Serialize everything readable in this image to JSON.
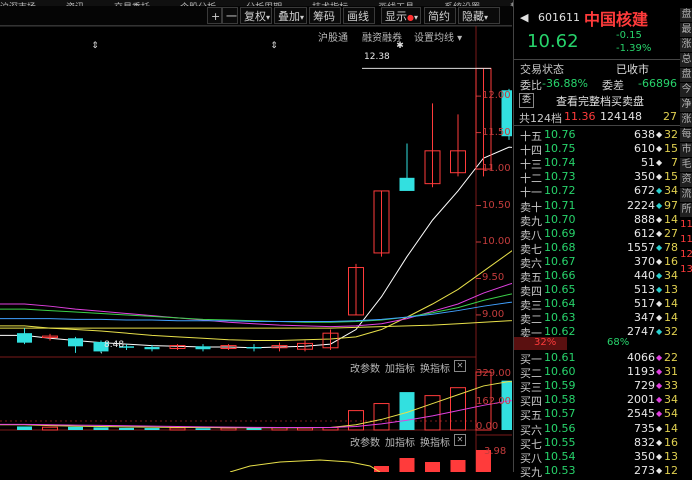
{
  "topbar": {
    "tabs": [
      "沪深市场",
      "资讯",
      "交易委托",
      "个股分析",
      "分析周期",
      "技术指标",
      "画线工具",
      "系统设置",
      "帮助"
    ]
  },
  "toolbar": {
    "plus": "+",
    "minus": "一",
    "fuquan": "复权",
    "diejia": "叠加",
    "chouma": "筹码",
    "huaxian": "画线",
    "xianshi": "显示",
    "jianyue": "简约",
    "yincang": "隐藏",
    "caret": "▾",
    "reddot": "●"
  },
  "chart_header": {
    "hugutong": "沪股通",
    "rongzi": "融资融券",
    "settings": "设置均线 ▾"
  },
  "price_axis": [
    "12.00",
    "11.50",
    "11.00",
    "10.50",
    "10.00",
    "9.50",
    "9.00"
  ],
  "annotations": {
    "high": "12.38",
    "low": "8.48"
  },
  "indicators": [
    {
      "buttons": [
        "改参数",
        "加指标",
        "换指标"
      ],
      "ticks": [
        "329.00",
        "162.00",
        "0.00"
      ]
    },
    {
      "buttons": [
        "改参数",
        "加指标",
        "换指标"
      ],
      "ticks": [
        "3.98"
      ]
    }
  ],
  "chart_data": {
    "type": "candlestick",
    "y_range": [
      8.3,
      12.55
    ],
    "candles": [
      {
        "o": 8.75,
        "h": 8.82,
        "l": 8.6,
        "c": 8.62
      },
      {
        "o": 8.69,
        "h": 8.74,
        "l": 8.65,
        "c": 8.71
      },
      {
        "o": 8.68,
        "h": 8.7,
        "l": 8.48,
        "c": 8.57
      },
      {
        "o": 8.63,
        "h": 8.65,
        "l": 8.48,
        "c": 8.5
      },
      {
        "o": 8.57,
        "h": 8.6,
        "l": 8.52,
        "c": 8.55
      },
      {
        "o": 8.56,
        "h": 8.59,
        "l": 8.5,
        "c": 8.53
      },
      {
        "o": 8.54,
        "h": 8.6,
        "l": 8.52,
        "c": 8.58
      },
      {
        "o": 8.57,
        "h": 8.6,
        "l": 8.5,
        "c": 8.53
      },
      {
        "o": 8.54,
        "h": 8.6,
        "l": 8.52,
        "c": 8.58
      },
      {
        "o": 8.56,
        "h": 8.6,
        "l": 8.5,
        "c": 8.54
      },
      {
        "o": 8.55,
        "h": 8.62,
        "l": 8.5,
        "c": 8.58
      },
      {
        "o": 8.53,
        "h": 8.65,
        "l": 8.5,
        "c": 8.61
      },
      {
        "o": 8.55,
        "h": 8.8,
        "l": 8.52,
        "c": 8.75
      },
      {
        "o": 9.0,
        "h": 9.7,
        "l": 9.0,
        "c": 9.65
      },
      {
        "o": 9.85,
        "h": 10.7,
        "l": 9.8,
        "c": 10.7
      },
      {
        "o": 10.88,
        "h": 11.35,
        "l": 10.8,
        "c": 10.7
      },
      {
        "o": 10.8,
        "h": 11.9,
        "l": 10.75,
        "c": 11.25
      },
      {
        "o": 10.95,
        "h": 11.75,
        "l": 10.9,
        "c": 11.25
      },
      {
        "o": 11.0,
        "h": 12.38,
        "l": 10.9,
        "c": 12.38
      },
      {
        "o": 12.08,
        "h": 12.1,
        "l": 11.4,
        "c": 11.45
      },
      {
        "o": 11.48,
        "h": 11.52,
        "l": 10.75,
        "c": 10.8
      },
      {
        "o": 10.77,
        "h": 10.85,
        "l": 10.5,
        "c": 10.62
      }
    ],
    "ma_lines": [
      {
        "color": "#ffffff",
        "values": [
          8.72,
          8.68,
          8.65,
          8.62,
          8.6,
          8.58,
          8.57,
          8.56,
          8.56,
          8.55,
          8.56,
          8.57,
          8.6,
          8.8,
          9.25,
          9.8,
          10.3,
          10.7,
          11.15,
          11.3,
          11.28,
          11.25
        ]
      },
      {
        "color": "#e8e04a",
        "values": [
          8.85,
          8.82,
          8.8,
          8.78,
          8.75,
          8.72,
          8.7,
          8.68,
          8.66,
          8.65,
          8.65,
          8.66,
          8.67,
          8.7,
          8.8,
          8.97,
          9.15,
          9.35,
          9.6,
          9.85,
          10.1,
          10.45
        ]
      },
      {
        "color": "#e040e0",
        "values": [
          9.15,
          9.12,
          9.08,
          9.05,
          9.02,
          8.99,
          8.96,
          8.93,
          8.9,
          8.88,
          8.86,
          8.85,
          8.84,
          8.85,
          8.88,
          8.95,
          9.05,
          9.15,
          9.3,
          9.42,
          9.52,
          9.62
        ]
      },
      {
        "color": "#3cd04a",
        "values": [
          9.08,
          9.06,
          9.04,
          9.02,
          9.0,
          8.98,
          8.96,
          8.94,
          8.93,
          8.92,
          8.91,
          8.9,
          8.9,
          8.91,
          8.93,
          8.97,
          9.03,
          9.1,
          9.2,
          9.28,
          9.35,
          9.4
        ]
      },
      {
        "color": "#40a0ff",
        "values": [
          8.95,
          8.95,
          8.94,
          8.94,
          8.93,
          8.93,
          8.92,
          8.92,
          8.92,
          8.91,
          8.91,
          8.91,
          8.91,
          8.92,
          8.94,
          8.97,
          9.01,
          9.06,
          9.12,
          9.17,
          9.22,
          9.27
        ]
      },
      {
        "color": "#e8e04a",
        "values": [
          8.82,
          8.82,
          8.82,
          8.82,
          8.82,
          8.82,
          8.82,
          8.82,
          8.82,
          8.82,
          8.82,
          8.82,
          8.82,
          8.83,
          8.84,
          8.85,
          8.86,
          8.88,
          8.9,
          8.92,
          8.94,
          8.95
        ]
      }
    ],
    "volumes": [
      20,
      16,
      18,
      15,
      12,
      11,
      12,
      10,
      11,
      12,
      13,
      12,
      14,
      110,
      150,
      215,
      195,
      240,
      329,
      280,
      230,
      178
    ],
    "vol_ma": [
      {
        "color": "#e8e04a",
        "values": [
          30,
          25,
          22,
          20,
          18,
          16,
          15,
          14,
          13,
          13,
          13,
          13,
          14,
          30,
          60,
          100,
          150,
          200,
          250,
          275,
          265,
          240
        ]
      },
      {
        "color": "#e040e0",
        "values": [
          32,
          30,
          28,
          26,
          24,
          22,
          20,
          18,
          16,
          15,
          14,
          14,
          14,
          20,
          35,
          55,
          80,
          110,
          140,
          165,
          180,
          190
        ]
      }
    ]
  },
  "stock": {
    "code": "601611",
    "name": "中国核建",
    "price": "10.62",
    "change": "-0.15",
    "pct": "-1.39%"
  },
  "status": {
    "label": "交易状态",
    "value": "已收市"
  },
  "weibi": {
    "label1": "委比",
    "val1": "-36.88%",
    "label2": "委差",
    "val2": "-66896"
  },
  "full_book": {
    "icon_label": "委",
    "text": "查看完整档买卖盘"
  },
  "total": {
    "label": "共124档",
    "price": "11.36",
    "vol": "124148",
    "cnt": "27"
  },
  "asks": [
    {
      "label": "十五",
      "price": "10.76",
      "vol": "638",
      "cnt": "32",
      "dot": "#e8e8e8"
    },
    {
      "label": "十四",
      "price": "10.75",
      "vol": "610",
      "cnt": "15",
      "dot": "#e8e8e8"
    },
    {
      "label": "十三",
      "price": "10.74",
      "vol": "51",
      "cnt": "7",
      "dot": "#e8e8e8"
    },
    {
      "label": "十二",
      "price": "10.73",
      "vol": "350",
      "cnt": "15",
      "dot": "#e8e8e8"
    },
    {
      "label": "十一",
      "price": "10.72",
      "vol": "672",
      "cnt": "34",
      "dot": "#2ad0d0"
    },
    {
      "label": "卖十",
      "price": "10.71",
      "vol": "2224",
      "cnt": "97",
      "dot": "#2ad0d0"
    },
    {
      "label": "卖九",
      "price": "10.70",
      "vol": "888",
      "cnt": "14",
      "dot": "#e8e8e8"
    },
    {
      "label": "卖八",
      "price": "10.69",
      "vol": "612",
      "cnt": "27",
      "dot": "#e8e8e8"
    },
    {
      "label": "卖七",
      "price": "10.68",
      "vol": "1557",
      "cnt": "78",
      "dot": "#2ad0d0"
    },
    {
      "label": "卖六",
      "price": "10.67",
      "vol": "370",
      "cnt": "16",
      "dot": "#e8e8e8"
    },
    {
      "label": "卖五",
      "price": "10.66",
      "vol": "440",
      "cnt": "34",
      "dot": "#2ad0d0"
    },
    {
      "label": "卖四",
      "price": "10.65",
      "vol": "513",
      "cnt": "13",
      "dot": "#2ad0d0"
    },
    {
      "label": "卖三",
      "price": "10.64",
      "vol": "517",
      "cnt": "14",
      "dot": "#e8e8e8"
    },
    {
      "label": "卖二",
      "price": "10.63",
      "vol": "347",
      "cnt": "14",
      "dot": "#e8e8e8"
    },
    {
      "label": "卖一",
      "price": "10.62",
      "vol": "2747",
      "cnt": "32",
      "dot": "#2ad0d0"
    }
  ],
  "ratio": {
    "sell": "32%",
    "buy": "68%",
    "sell_frac": 0.32
  },
  "bids": [
    {
      "label": "买一",
      "price": "10.61",
      "vol": "4066",
      "cnt": "22",
      "dot": "#e040e0"
    },
    {
      "label": "买二",
      "price": "10.60",
      "vol": "1193",
      "cnt": "31",
      "dot": "#e040e0"
    },
    {
      "label": "买三",
      "price": "10.59",
      "vol": "729",
      "cnt": "33",
      "dot": "#e040e0"
    },
    {
      "label": "买四",
      "price": "10.58",
      "vol": "2001",
      "cnt": "34",
      "dot": "#e040e0"
    },
    {
      "label": "买五",
      "price": "10.57",
      "vol": "2545",
      "cnt": "54",
      "dot": "#e040e0"
    },
    {
      "label": "买六",
      "price": "10.56",
      "vol": "735",
      "cnt": "14",
      "dot": "#e8e8e8"
    },
    {
      "label": "买七",
      "price": "10.55",
      "vol": "832",
      "cnt": "16",
      "dot": "#e8e8e8"
    },
    {
      "label": "买八",
      "price": "10.54",
      "vol": "350",
      "cnt": "13",
      "dot": "#e8e8e8"
    },
    {
      "label": "买九",
      "price": "10.53",
      "vol": "273",
      "cnt": "12",
      "dot": "#e8e8e8"
    }
  ],
  "sidetabs": [
    "盘",
    "最",
    "涨",
    "总",
    "盘",
    "今",
    "净",
    "涨",
    "每",
    "市",
    "毛",
    "资",
    "流",
    "所",
    "11",
    "11",
    "12",
    "13"
  ]
}
